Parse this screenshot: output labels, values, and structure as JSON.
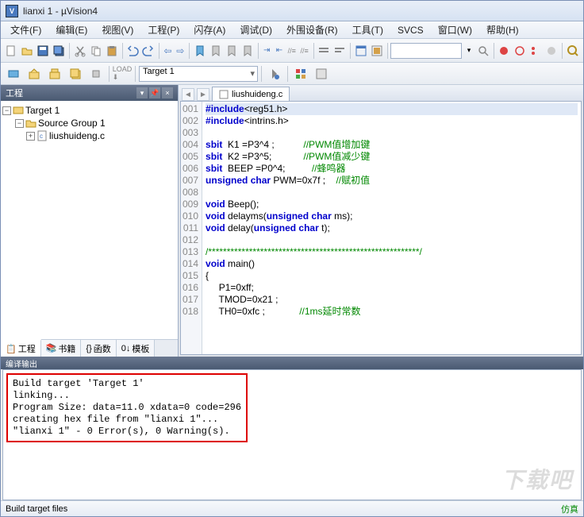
{
  "window": {
    "title": "lianxi 1 - µVision4"
  },
  "menu": {
    "file": "文件(F)",
    "edit": "编辑(E)",
    "view": "视图(V)",
    "project": "工程(P)",
    "flash": "闪存(A)",
    "debug": "调试(D)",
    "peripherals": "外围设备(R)",
    "tools": "工具(T)",
    "svcs": "SVCS",
    "window": "窗口(W)",
    "help": "帮助(H)"
  },
  "toolbar2": {
    "target_selected": "Target 1"
  },
  "project_panel": {
    "title": "工程",
    "tree": {
      "root": "Target 1",
      "group": "Source Group 1",
      "file": "liushuideng.c"
    },
    "tabs": {
      "project": "工程",
      "books": "书籍",
      "funcs": "函数",
      "templates": "模板"
    }
  },
  "editor": {
    "tab": "liushuideng.c",
    "lines": [
      {
        "n": "001",
        "html": "<span class='k'>#include</span>&lt;reg51.h&gt;",
        "hl": true
      },
      {
        "n": "002",
        "html": "<span class='k'>#include</span>&lt;intrins.h&gt;"
      },
      {
        "n": "003",
        "html": ""
      },
      {
        "n": "004",
        "html": "<span class='k'>sbit</span>  K1 =P3^4 ;           <span class='cm'>//PWM值增加键</span>"
      },
      {
        "n": "005",
        "html": "<span class='k'>sbit</span>  K2 =P3^5;            <span class='cm'>//PWM值减少键</span>"
      },
      {
        "n": "006",
        "html": "<span class='k'>sbit</span>  BEEP =P0^4;          <span class='cm'>//蜂鸣器</span>"
      },
      {
        "n": "007",
        "html": "<span class='k'>unsigned</span> <span class='k'>char</span> PWM=0x7f ;    <span class='cm'>//赋初值</span>"
      },
      {
        "n": "008",
        "html": ""
      },
      {
        "n": "009",
        "html": "<span class='k'>void</span> Beep();"
      },
      {
        "n": "010",
        "html": "<span class='k'>void</span> delayms(<span class='k'>unsigned</span> <span class='k'>char</span> ms);"
      },
      {
        "n": "011",
        "html": "<span class='k'>void</span> delay(<span class='k'>unsigned</span> <span class='k'>char</span> t);"
      },
      {
        "n": "012",
        "html": ""
      },
      {
        "n": "013",
        "html": "<span class='cm'>/*********************************************************/</span>"
      },
      {
        "n": "014",
        "html": "<span class='k'>void</span> main()"
      },
      {
        "n": "015",
        "html": "{"
      },
      {
        "n": "016",
        "html": "     P1=0xff;"
      },
      {
        "n": "017",
        "html": "     TMOD=0x21 ;"
      },
      {
        "n": "018",
        "html": "     TH0=0xfc ;             <span class='cm'>//1ms延时常数</span>"
      }
    ]
  },
  "output": {
    "title": "编译输出",
    "lines": [
      "Build target 'Target 1'",
      "linking...",
      "Program Size: data=11.0 xdata=0 code=296",
      "creating hex file from \"lianxi 1\"...",
      "\"lianxi 1\" - 0 Error(s), 0 Warning(s)."
    ]
  },
  "status": {
    "left": "Build target files",
    "right": "仿真"
  },
  "watermark": "下载吧"
}
